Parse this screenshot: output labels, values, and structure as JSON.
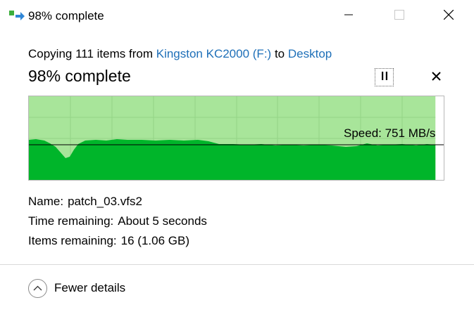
{
  "window": {
    "title": "98% complete",
    "icon": "file-copy-icon",
    "controls": [
      "minimize-icon",
      "maximize-icon",
      "close-icon"
    ]
  },
  "dialog": {
    "subtitle_prefix": "Copying 111 items from",
    "source": "Kingston KC2000 (F:)",
    "subtitle_to": "to",
    "destination": "Desktop",
    "progress_title": "98% complete",
    "progress_percent": 98,
    "pause_icon": "pause-icon",
    "cancel_icon": "close-icon"
  },
  "graph": {
    "speed_label": "Speed: 751 MB/s",
    "fill_color": "#00b52a",
    "progress_color": "#a8e59a",
    "remaining_color": "#ffffff",
    "line_color": "#000000"
  },
  "details": {
    "name_label": "Name:",
    "name_value": "patch_03.vfs2",
    "time_label": "Time remaining:",
    "time_value": "About 5 seconds",
    "items_label": "Items remaining:",
    "items_value": "16 (1.06 GB)"
  },
  "footer": {
    "toggle_label": "Fewer details",
    "toggle_icon": "chevron-up-icon"
  }
}
